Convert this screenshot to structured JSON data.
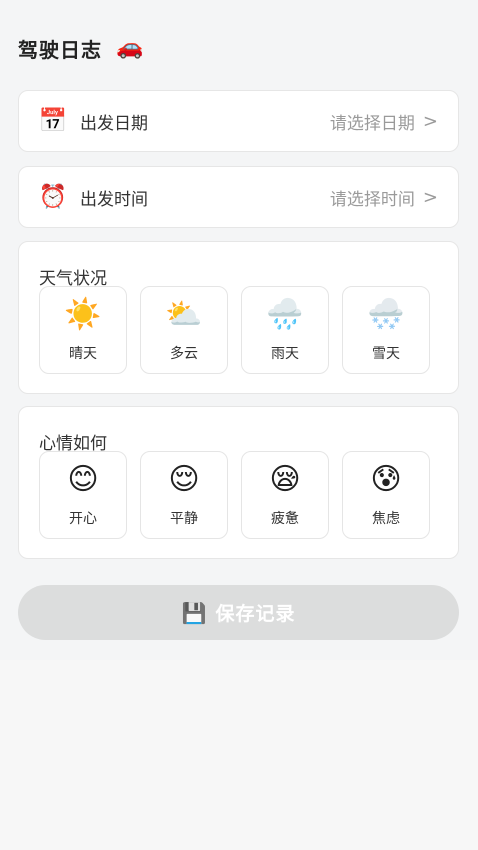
{
  "page": {
    "title": "驾驶日志",
    "title_icon": "🚗"
  },
  "departure_date": {
    "icon": "📅",
    "label": "出发日期",
    "value": "请选择日期",
    "chevron": ">"
  },
  "departure_time": {
    "icon": "⏰",
    "label": "出发时间",
    "value": "请选择时间",
    "chevron": ">"
  },
  "weather": {
    "title": "天气状况",
    "options": [
      {
        "icon": "☀️",
        "label": "晴天"
      },
      {
        "icon": "⛅",
        "label": "多云"
      },
      {
        "icon": "🌧️",
        "label": "雨天"
      },
      {
        "icon": "🌨️",
        "label": "雪天"
      }
    ]
  },
  "mood": {
    "title": "心情如何",
    "options": [
      {
        "icon": "😊",
        "label": "开心"
      },
      {
        "icon": "😌",
        "label": "平静"
      },
      {
        "icon": "😪",
        "label": "疲惫"
      },
      {
        "icon": "😰",
        "label": "焦虑"
      }
    ]
  },
  "save_button": {
    "icon": "💾",
    "label": "保存记录"
  },
  "colors": {
    "page_background": "#f7f7f7",
    "card_background": "#ffffff",
    "card_border": "#e6e6e6",
    "primary_text": "#333333",
    "placeholder_text": "#9a9a9a",
    "disabled_button_background": "#dcdddd",
    "disabled_button_text": "#ffffff"
  }
}
